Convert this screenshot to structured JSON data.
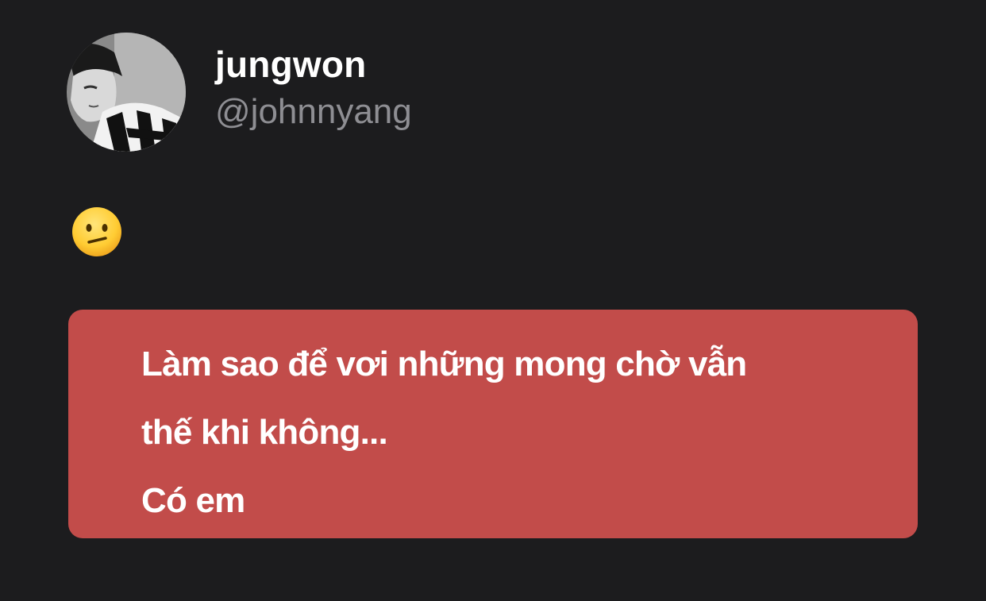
{
  "profile": {
    "display_name": "jungwon",
    "handle": "@johnnyang",
    "avatar_icon": "avatar-photo"
  },
  "post": {
    "emoji_icon": "confused-face-emoji"
  },
  "lyrics_card": {
    "background_color": "#c24c4a",
    "lines": [
      "Làm sao để vơi những mong chờ vẫn",
      "thế khi không...",
      "Có em"
    ]
  },
  "colors": {
    "background": "#1c1c1e",
    "display_name": "#ffffff",
    "handle": "#8e8e93"
  }
}
